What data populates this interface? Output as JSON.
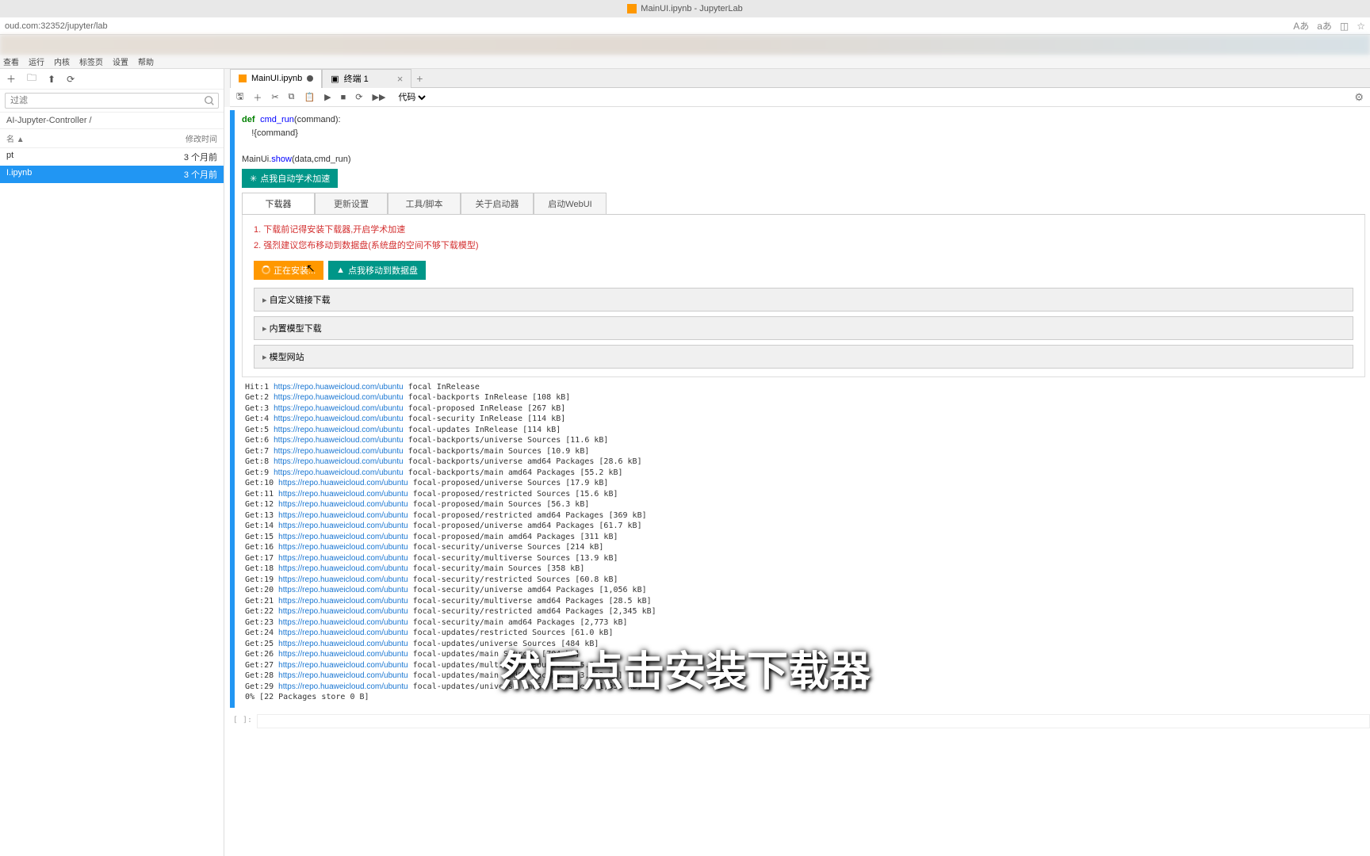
{
  "window": {
    "title": "MainUI.ipynb - JupyterLab"
  },
  "address": {
    "url": "oud.com:32352/jupyter/lab"
  },
  "menubar": [
    "查看",
    "运行",
    "内核",
    "标签页",
    "设置",
    "帮助"
  ],
  "sidebar": {
    "search_placeholder": "过滤",
    "breadcrumb": "AI-Jupyter-Controller /",
    "header_name": "名",
    "header_time": "修改时间",
    "files": [
      {
        "name": "pt",
        "time": "3 个月前",
        "selected": false
      },
      {
        "name": "I.ipynb",
        "time": "3 个月前",
        "selected": true
      }
    ]
  },
  "tabs": [
    {
      "label": "MainUI.ipynb",
      "dirty": true,
      "active": true
    },
    {
      "label": "终端 1",
      "active": false
    }
  ],
  "toolbar": {
    "celltype": "代码"
  },
  "code": {
    "def": "def",
    "fn": "cmd_run",
    "args": "(command):",
    "body": "    !{command}",
    "call": "MainUi.",
    "method": "show",
    "callargs": "(data,cmd_run)"
  },
  "widget": {
    "accel_btn": "点我自动学术加速",
    "tabs": [
      "下载器",
      "更新设置",
      "工具/脚本",
      "关于启动器",
      "启动WebUI"
    ],
    "tip1": "1. 下载前记得安装下载器,开启学术加速",
    "tip2": "2. 强烈建议您布移动到数据盘(系统盘的空间不够下载模型)",
    "btn_install": "正在安装...",
    "btn_move": "点我移动到数据盘",
    "acc1": "自定义链接下载",
    "acc2": "内置模型下载",
    "acc3": "模型网站"
  },
  "output_lines": [
    {
      "p": "Hit:1 ",
      "u": "https://repo.huaweicloud.com/ubuntu",
      "s": " focal InRelease"
    },
    {
      "p": "Get:2 ",
      "u": "https://repo.huaweicloud.com/ubuntu",
      "s": " focal-backports InRelease [108 kB]"
    },
    {
      "p": "Get:3 ",
      "u": "https://repo.huaweicloud.com/ubuntu",
      "s": " focal-proposed InRelease [267 kB]"
    },
    {
      "p": "Get:4 ",
      "u": "https://repo.huaweicloud.com/ubuntu",
      "s": " focal-security InRelease [114 kB]"
    },
    {
      "p": "Get:5 ",
      "u": "https://repo.huaweicloud.com/ubuntu",
      "s": " focal-updates InRelease [114 kB]"
    },
    {
      "p": "Get:6 ",
      "u": "https://repo.huaweicloud.com/ubuntu",
      "s": " focal-backports/universe Sources [11.6 kB]"
    },
    {
      "p": "Get:7 ",
      "u": "https://repo.huaweicloud.com/ubuntu",
      "s": " focal-backports/main Sources [10.9 kB]"
    },
    {
      "p": "Get:8 ",
      "u": "https://repo.huaweicloud.com/ubuntu",
      "s": " focal-backports/universe amd64 Packages [28.6 kB]"
    },
    {
      "p": "Get:9 ",
      "u": "https://repo.huaweicloud.com/ubuntu",
      "s": " focal-backports/main amd64 Packages [55.2 kB]"
    },
    {
      "p": "Get:10 ",
      "u": "https://repo.huaweicloud.com/ubuntu",
      "s": " focal-proposed/universe Sources [17.9 kB]"
    },
    {
      "p": "Get:11 ",
      "u": "https://repo.huaweicloud.com/ubuntu",
      "s": " focal-proposed/restricted Sources [15.6 kB]"
    },
    {
      "p": "Get:12 ",
      "u": "https://repo.huaweicloud.com/ubuntu",
      "s": " focal-proposed/main Sources [56.3 kB]"
    },
    {
      "p": "Get:13 ",
      "u": "https://repo.huaweicloud.com/ubuntu",
      "s": " focal-proposed/restricted amd64 Packages [369 kB]"
    },
    {
      "p": "Get:14 ",
      "u": "https://repo.huaweicloud.com/ubuntu",
      "s": " focal-proposed/universe amd64 Packages [61.7 kB]"
    },
    {
      "p": "Get:15 ",
      "u": "https://repo.huaweicloud.com/ubuntu",
      "s": " focal-proposed/main amd64 Packages [311 kB]"
    },
    {
      "p": "Get:16 ",
      "u": "https://repo.huaweicloud.com/ubuntu",
      "s": " focal-security/universe Sources [214 kB]"
    },
    {
      "p": "Get:17 ",
      "u": "https://repo.huaweicloud.com/ubuntu",
      "s": " focal-security/multiverse Sources [13.9 kB]"
    },
    {
      "p": "Get:18 ",
      "u": "https://repo.huaweicloud.com/ubuntu",
      "s": " focal-security/main Sources [358 kB]"
    },
    {
      "p": "Get:19 ",
      "u": "https://repo.huaweicloud.com/ubuntu",
      "s": " focal-security/restricted Sources [60.8 kB]"
    },
    {
      "p": "Get:20 ",
      "u": "https://repo.huaweicloud.com/ubuntu",
      "s": " focal-security/universe amd64 Packages [1,056 kB]"
    },
    {
      "p": "Get:21 ",
      "u": "https://repo.huaweicloud.com/ubuntu",
      "s": " focal-security/multiverse amd64 Packages [28.5 kB]"
    },
    {
      "p": "Get:22 ",
      "u": "https://repo.huaweicloud.com/ubuntu",
      "s": " focal-security/restricted amd64 Packages [2,345 kB]"
    },
    {
      "p": "Get:23 ",
      "u": "https://repo.huaweicloud.com/ubuntu",
      "s": " focal-security/main amd64 Packages [2,773 kB]"
    },
    {
      "p": "Get:24 ",
      "u": "https://repo.huaweicloud.com/ubuntu",
      "s": " focal-updates/restricted Sources [61.0 kB]"
    },
    {
      "p": "Get:25 ",
      "u": "https://repo.huaweicloud.com/ubuntu",
      "s": " focal-updates/universe Sources [484 kB]"
    },
    {
      "p": "Get:26 ",
      "u": "https://repo.huaweicloud.com/ubuntu",
      "s": " focal-updates/main Sources [704 kB]"
    },
    {
      "p": "Get:27 ",
      "u": "https://repo.huaweicloud.com/ubuntu",
      "s": " focal-updates/multiverse Sources [25.5 kB]"
    },
    {
      "p": "Get:28 ",
      "u": "https://repo.huaweicloud.com/ubuntu",
      "s": " focal-updates/main amd64 Packages [3,252 kB]"
    },
    {
      "p": "Get:29 ",
      "u": "https://repo.huaweicloud.com/ubuntu",
      "s": " focal-updates/universe amd64 Packages [1,351 kB]"
    },
    {
      "p": "0% [22 Packages store 0 B]",
      "u": "",
      "s": ""
    }
  ],
  "caption": "然后点击安装下载器"
}
